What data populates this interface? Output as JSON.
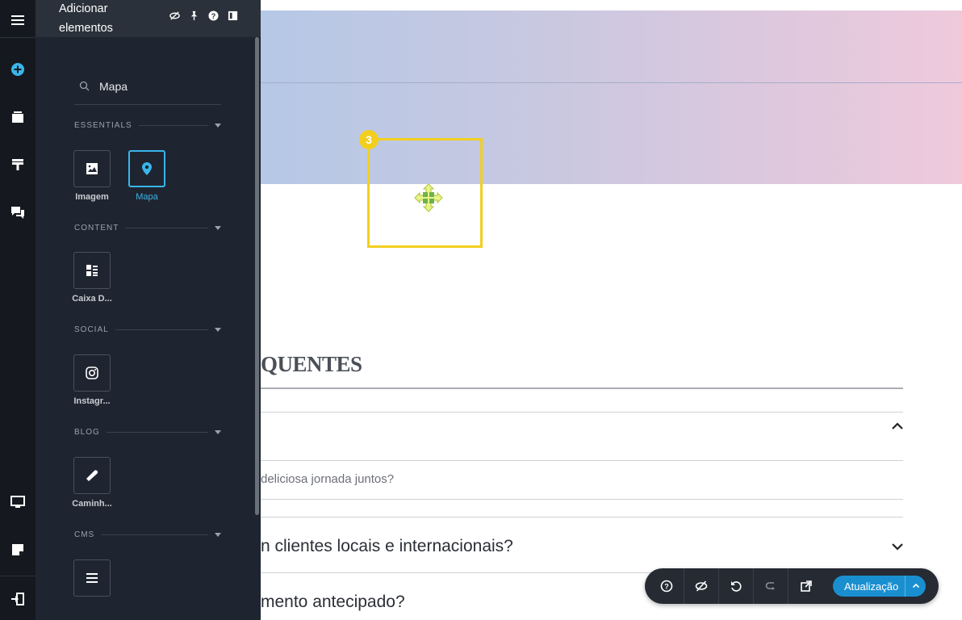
{
  "panel": {
    "title": "Adicionar elementos",
    "search_value": "Mapa",
    "sections": [
      {
        "label": "ESSENTIALS",
        "items": [
          {
            "label": "Imagem",
            "icon": "image-icon"
          },
          {
            "label": "Mapa",
            "icon": "map-pin-icon",
            "active": true
          }
        ]
      },
      {
        "label": "CONTENT",
        "items": [
          {
            "label": "Caixa D...",
            "icon": "content-box-icon"
          }
        ]
      },
      {
        "label": "SOCIAL",
        "items": [
          {
            "label": "Instagr...",
            "icon": "instagram-icon"
          }
        ]
      },
      {
        "label": "BLOG",
        "items": [
          {
            "label": "Caminh...",
            "icon": "path-icon"
          }
        ]
      },
      {
        "label": "CMS",
        "items": [
          {
            "label": "",
            "icon": "list-icon"
          }
        ]
      }
    ]
  },
  "canvas": {
    "drop_badge": "3",
    "faq_heading": "QUENTES",
    "faq_answer": "deliciosa jornada juntos?",
    "faq_q2": "n clientes locais e internacionais?",
    "faq_q3": "mento antecipado?"
  },
  "toolbar": {
    "update_label": "Atualização"
  },
  "colors": {
    "accent": "#3ab6ea",
    "highlight": "#f2cf1f",
    "update_button": "#1a8fd0"
  }
}
